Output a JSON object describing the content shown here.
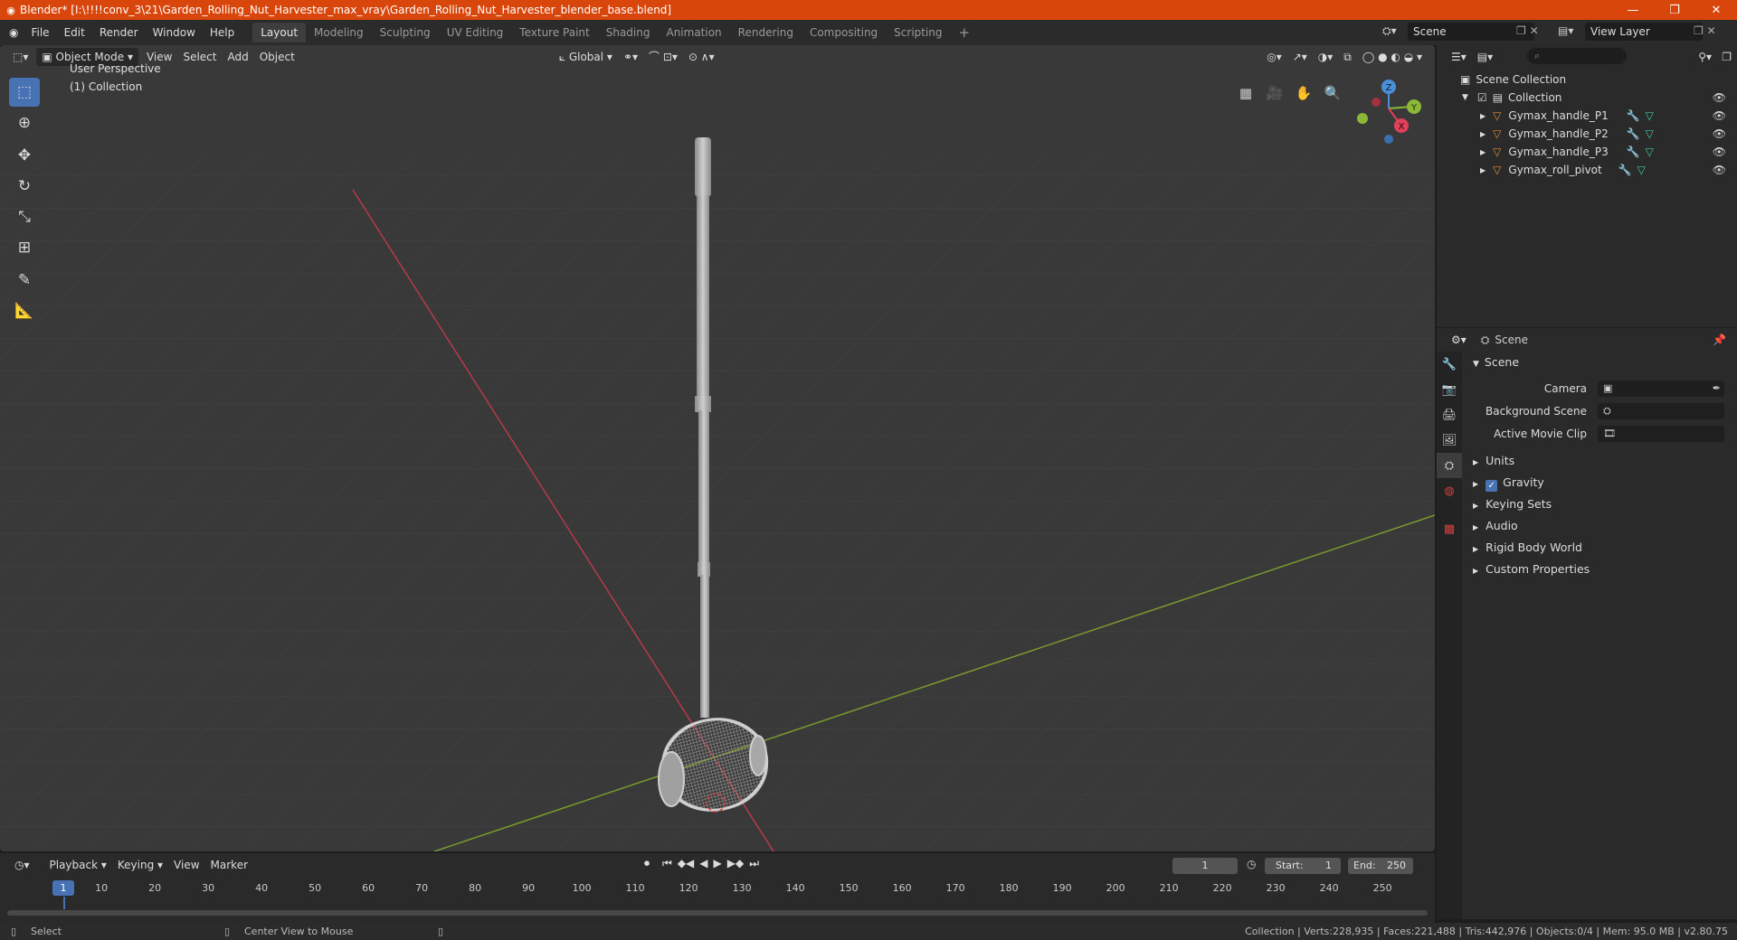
{
  "window": {
    "title": "Blender* [I:\\!!!!conv_3\\21\\Garden_Rolling_Nut_Harvester_max_vray\\Garden_Rolling_Nut_Harvester_blender_base.blend]",
    "minimize": "—",
    "maximize": "❐",
    "close": "✕"
  },
  "menu": {
    "items": [
      "File",
      "Edit",
      "Render",
      "Window",
      "Help"
    ]
  },
  "workspaces": [
    "Layout",
    "Modeling",
    "Sculpting",
    "UV Editing",
    "Texture Paint",
    "Shading",
    "Animation",
    "Rendering",
    "Compositing",
    "Scripting"
  ],
  "active_workspace": "Layout",
  "scene_field": "Scene",
  "view_layer_field": "View Layer",
  "viewport": {
    "mode": "Object Mode",
    "menus": [
      "View",
      "Select",
      "Add",
      "Object"
    ],
    "orientation": "Global",
    "perspective_label": "User Perspective",
    "collection_label": "(1) Collection",
    "gizmo_axes": {
      "x": "X",
      "y": "Y",
      "z": "Z"
    }
  },
  "tools": [
    {
      "name": "select-box-tool",
      "glyph": "⬚"
    },
    {
      "name": "cursor-tool",
      "glyph": "⊕"
    },
    {
      "name": "move-tool",
      "glyph": "✥"
    },
    {
      "name": "rotate-tool",
      "glyph": "↻"
    },
    {
      "name": "scale-tool",
      "glyph": "⤡"
    },
    {
      "name": "transform-tool",
      "glyph": "⊞"
    },
    {
      "name": "annotate-tool",
      "glyph": "✎"
    },
    {
      "name": "measure-tool",
      "glyph": "📐"
    }
  ],
  "outliner": {
    "root": "Scene Collection",
    "collection": "Collection",
    "objects": [
      "Gymax_handle_P1",
      "Gymax_handle_P2",
      "Gymax_handle_P3",
      "Gymax_roll_pivot"
    ],
    "search_placeholder": "⌕"
  },
  "properties": {
    "context": "Scene",
    "panel": "Scene",
    "fields": [
      {
        "label": "Camera",
        "value": ""
      },
      {
        "label": "Background Scene",
        "value": ""
      },
      {
        "label": "Active Movie Clip",
        "value": ""
      }
    ],
    "subpanels": [
      "Units",
      "Gravity",
      "Keying Sets",
      "Audio",
      "Rigid Body World",
      "Custom Properties"
    ]
  },
  "timeline": {
    "menus": [
      "Playback",
      "Keying",
      "View",
      "Marker"
    ],
    "current_frame": "1",
    "start_label": "Start:",
    "start": "1",
    "end_label": "End:",
    "end": "250",
    "ticks": [
      "1",
      "10",
      "20",
      "30",
      "40",
      "50",
      "60",
      "70",
      "80",
      "90",
      "100",
      "110",
      "120",
      "130",
      "140",
      "150",
      "160",
      "170",
      "180",
      "190",
      "200",
      "210",
      "220",
      "230",
      "240",
      "250"
    ]
  },
  "statusbar": {
    "left": "Select",
    "middle": "Center View to Mouse",
    "right": "Collection | Verts:228,935 | Faces:221,488 | Tris:442,976 | Objects:0/4 | Mem: 95.0 MB | v2.80.75"
  },
  "colors": {
    "titlebar": "#d9460b",
    "accent": "#4772b3",
    "x_axis": "#e0405a",
    "y_axis": "#8cb838",
    "z_axis": "#4a90d8"
  }
}
